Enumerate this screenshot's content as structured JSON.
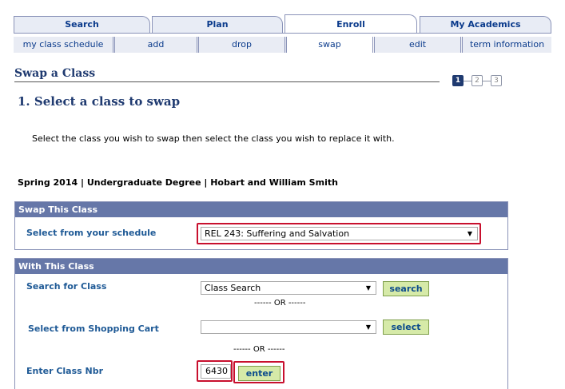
{
  "tabs": [
    {
      "label": "Search"
    },
    {
      "label": "Plan"
    },
    {
      "label": "Enroll"
    },
    {
      "label": "My Academics"
    }
  ],
  "subtabs": [
    {
      "label": "my class schedule"
    },
    {
      "label": "add"
    },
    {
      "label": "drop"
    },
    {
      "label": "swap"
    },
    {
      "label": "edit"
    },
    {
      "label": "term information"
    }
  ],
  "page": {
    "header": "Swap a Class",
    "steps": [
      "1",
      "2",
      "3"
    ],
    "step_title": "1.  Select a class to swap",
    "instructions": "Select the class you wish to swap then select the class you wish to replace it with.",
    "term": "Spring 2014 | Undergraduate Degree | Hobart and William Smith"
  },
  "swap_section": {
    "title": "Swap This Class",
    "label": "Select from your schedule",
    "selected": "REL 243: Suffering and Salvation"
  },
  "with_section": {
    "title": "With This Class",
    "search_label": "Search for Class",
    "search_selected": "Class Search",
    "search_button": "search",
    "or1": "------ OR ------",
    "cart_label": "Select from Shopping Cart",
    "cart_selected": "",
    "select_button": "select",
    "or2": "------ OR ------",
    "nbr_label": "Enter Class Nbr",
    "nbr_value": "6430",
    "enter_button": "enter"
  },
  "colors": {
    "section_header": "#6677a8",
    "highlight": "#c8102e",
    "button_bg": "#d6eaa8"
  }
}
